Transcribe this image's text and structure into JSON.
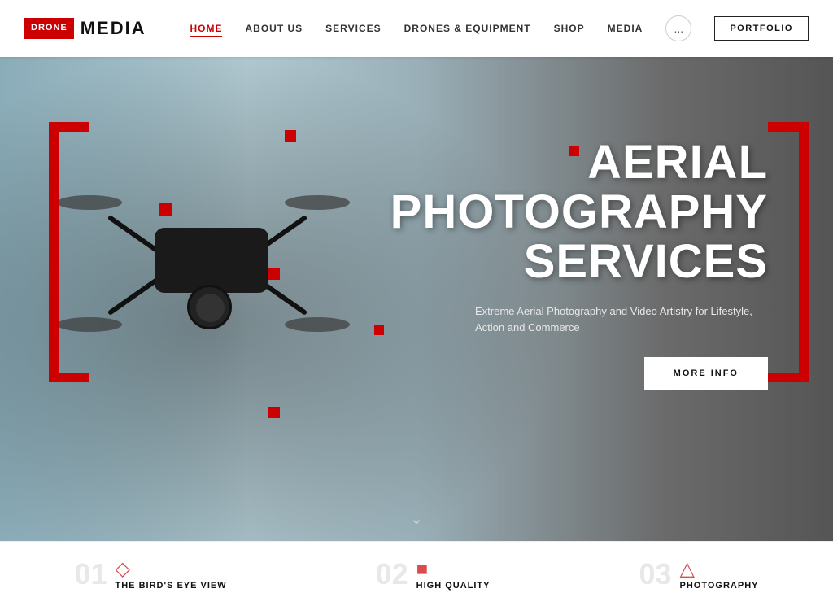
{
  "logo": {
    "box_text": "DRONE",
    "text": "MEDIA"
  },
  "nav": {
    "links": [
      {
        "label": "HOME",
        "active": true
      },
      {
        "label": "ABOUT US",
        "active": false
      },
      {
        "label": "SERVICES",
        "active": false
      },
      {
        "label": "DRONES & EQUIPMENT",
        "active": false
      },
      {
        "label": "SHOP",
        "active": false
      },
      {
        "label": "MEDIA",
        "active": false
      }
    ],
    "more_label": "...",
    "portfolio_label": "PORTFOLIO"
  },
  "hero": {
    "title_line1": "AERIAL PHOTOGRAPHY",
    "title_line2": "SERVICES",
    "subtitle": "Extreme Aerial Photography and Video Artistry for Lifestyle, Action and Commerce",
    "cta_label": "MORE INFO"
  },
  "bottom": {
    "items": [
      {
        "num": "01",
        "label": "THE BIRD'S EYE VIEW"
      },
      {
        "num": "02",
        "label": "HIGH QUALITY"
      },
      {
        "num": "03",
        "label": "PHOTOGRAPHY"
      }
    ]
  }
}
